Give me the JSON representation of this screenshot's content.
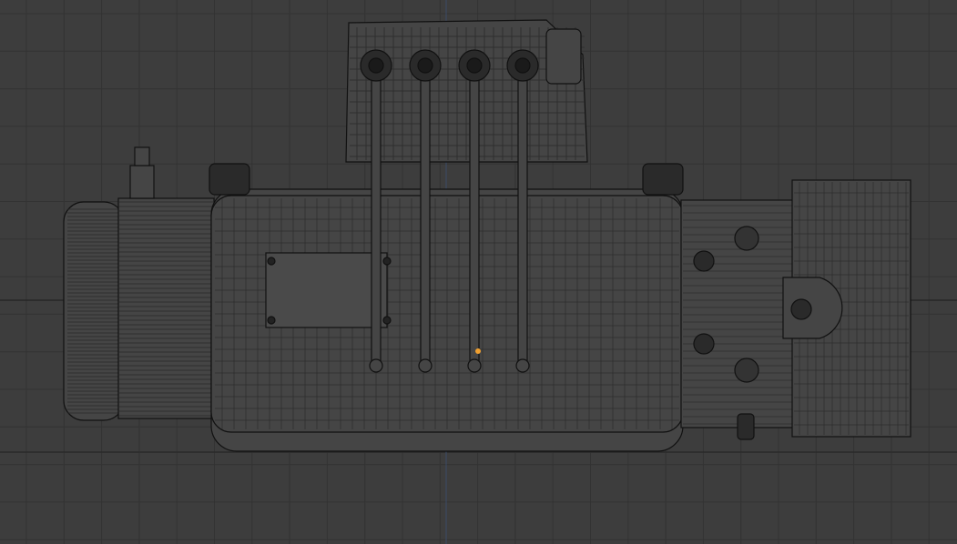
{
  "viewport": {
    "view": "orthographic-front",
    "shading": "wireframe",
    "object": "winch"
  },
  "colors": {
    "background": "#3d3d3d",
    "grid": "#333333",
    "axis_x": "#2a2a2a",
    "axis_y": "#3a4a66",
    "wire": "#111111",
    "fill": "#454545",
    "origin": "#f0a030"
  }
}
